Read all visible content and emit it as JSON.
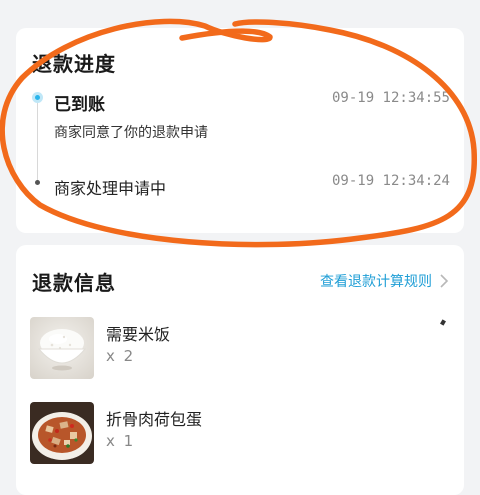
{
  "progress": {
    "title": "退款进度",
    "steps": [
      {
        "title": "已到账",
        "description": "商家同意了你的退款申请",
        "time": "09-19 12:34:55",
        "active": true
      },
      {
        "title": "商家处理申请中",
        "time": "09-19 12:34:24",
        "active": false
      }
    ]
  },
  "info": {
    "title": "退款信息",
    "rule_link": "查看退款计算规则",
    "items": [
      {
        "name": "需要米饭",
        "quantity": "x 2",
        "image": "rice-bowl"
      },
      {
        "name": "折骨肉荷包蛋",
        "quantity": "x 1",
        "image": "stir-fry-dish"
      }
    ]
  },
  "colors": {
    "accent": "#1f9ed6",
    "active_dot": "#29b4eb",
    "annotation": "#f26a1b",
    "background": "#f2f3f5"
  }
}
